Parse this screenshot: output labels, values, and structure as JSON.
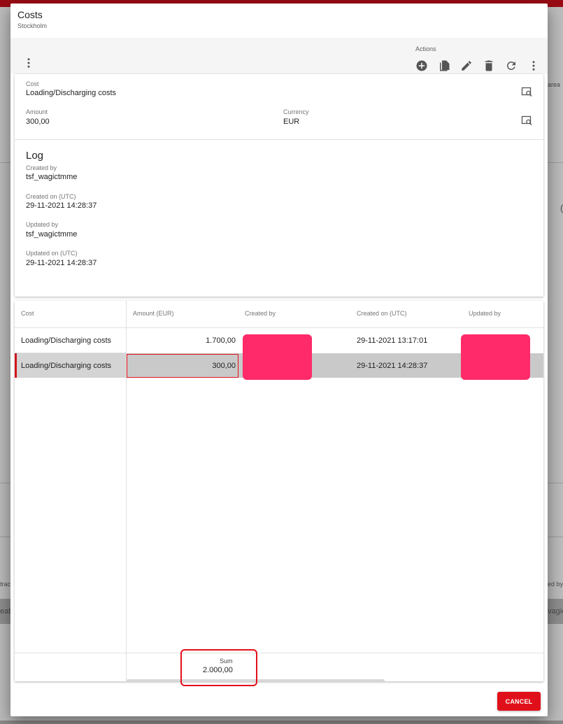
{
  "dialog": {
    "title": "Costs",
    "subtitle": "Stockholm",
    "actions_label": "Actions",
    "cancel_label": "CANCEL"
  },
  "toolbar": {
    "icons": [
      "more-vert-icon",
      "add-circle-icon",
      "copy-icon",
      "edit-icon",
      "delete-icon",
      "refresh-icon",
      "more-vert-icon"
    ]
  },
  "form": {
    "cost_label": "Cost",
    "cost_value": "Loading/Discharging costs",
    "amount_label": "Amount",
    "amount_value": "300,00",
    "currency_label": "Currency",
    "currency_value": "EUR"
  },
  "log": {
    "title": "Log",
    "created_by_label": "Created by",
    "created_by_value": "tsf_wagictmme",
    "created_on_label": "Created on (UTC)",
    "created_on_value": "29-11-2021 14:28:37",
    "updated_by_label": "Updated by",
    "updated_by_value": "tsf_wagictmme",
    "updated_on_label": "Updated on (UTC)",
    "updated_on_value": "29-11-2021 14:28:37"
  },
  "grid": {
    "columns": [
      "Cost",
      "Amount (EUR)",
      "Created by",
      "Created on (UTC)",
      "Updated by"
    ],
    "rows": [
      {
        "cost": "Loading/Discharging costs",
        "amount": "1.700,00",
        "created_on": "29-11-2021 13:17:01"
      },
      {
        "cost": "Loading/Discharging costs",
        "amount": "300,00",
        "created_on": "29-11-2021 14:28:37"
      }
    ],
    "sum_label": "Sum",
    "sum_value": "2.000,00"
  },
  "background": {
    "fragments": [
      "area",
      "(",
      "trac",
      "eat",
      "ed by",
      "vagic"
    ]
  },
  "colors": {
    "accent": "#e0101b",
    "redaction": "#fe2a69",
    "selected_row": "#c9c9c9"
  }
}
